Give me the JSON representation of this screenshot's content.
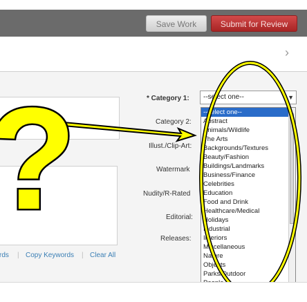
{
  "toolbar": {
    "save_label": "Save Work",
    "submit_label": "Submit for Review"
  },
  "nav": {
    "next_icon": "chevron-right-icon"
  },
  "keyword_links": {
    "keywords_partial": "rds",
    "copy_keywords": "Copy Keywords",
    "clear_all": "Clear All"
  },
  "form": {
    "category1_label": "* Category 1:",
    "category2_label": "Category 2:",
    "illust_label": "Illust./Clip-Art:",
    "watermark_label": "Watermark",
    "nudity_label": "Nudity/R-Rated",
    "editorial_label": "Editorial:",
    "releases_label": "Releases:",
    "category1_value": "--select one--"
  },
  "dropdown": {
    "options": [
      "--select one--",
      "Abstract",
      "Animals/Wildlife",
      "The Arts",
      "Backgrounds/Textures",
      "Beauty/Fashion",
      "Buildings/Landmarks",
      "Business/Finance",
      "Celebrities",
      "Education",
      "Food and Drink",
      "Healthcare/Medical",
      "Holidays",
      "Industrial",
      "Interiors",
      "Miscellaneous",
      "Nature",
      "Objects",
      "Parks/Outdoor",
      "People"
    ],
    "selected_index": 0
  },
  "annotation": {
    "symbol": "?",
    "fill_color": "#ffff00",
    "stroke_color": "#000000"
  }
}
